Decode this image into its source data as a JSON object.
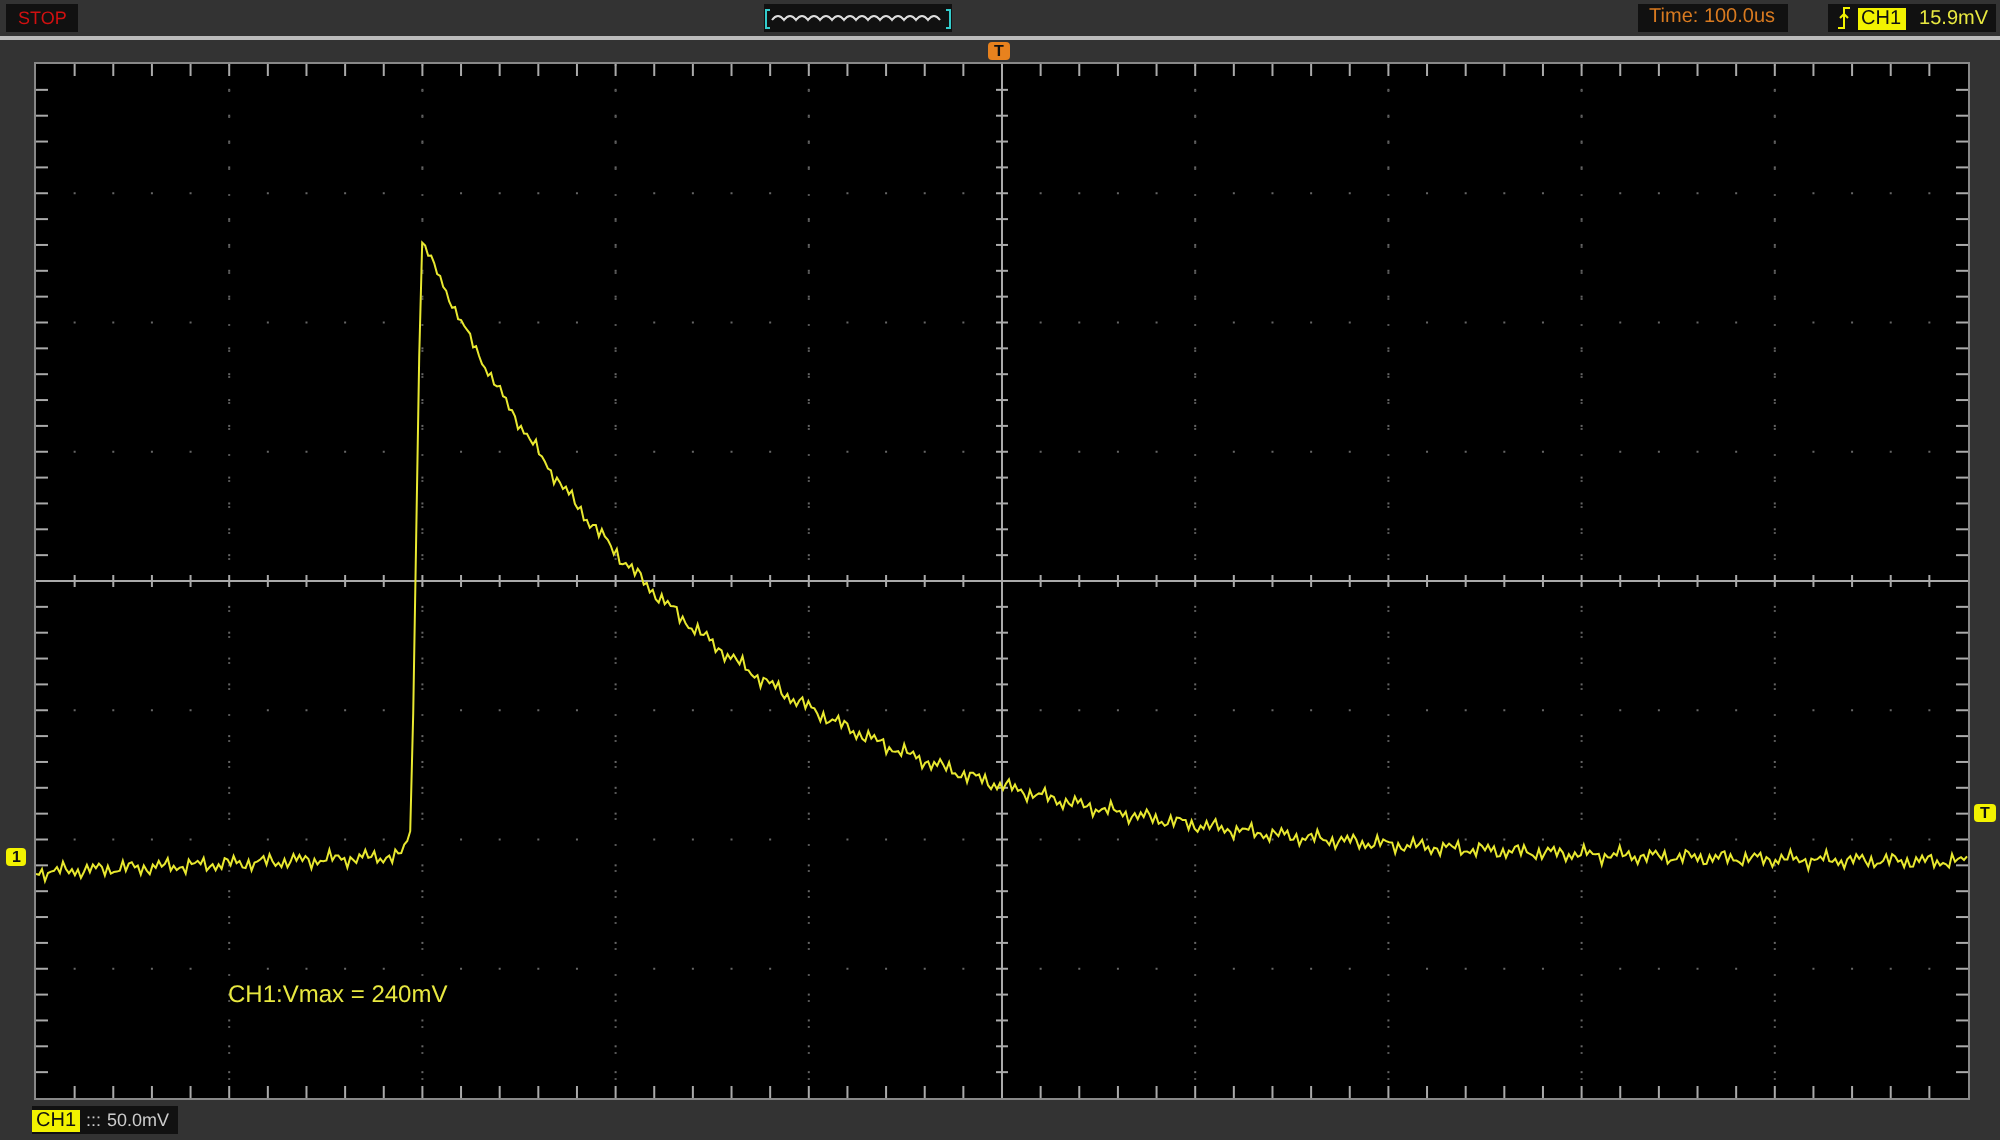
{
  "status": "STOP",
  "time_base": "Time: 100.0us",
  "trigger": {
    "edge_channel": "CH1",
    "voltage": "15.9mV"
  },
  "markers": {
    "trigger_position": "T",
    "channel": "1",
    "trigger_level": "T"
  },
  "measurement": "CH1:Vmax = 240mV",
  "channel_scale": {
    "channel": "CH1",
    "coupling": ":::",
    "scale": "50.0mV"
  }
}
